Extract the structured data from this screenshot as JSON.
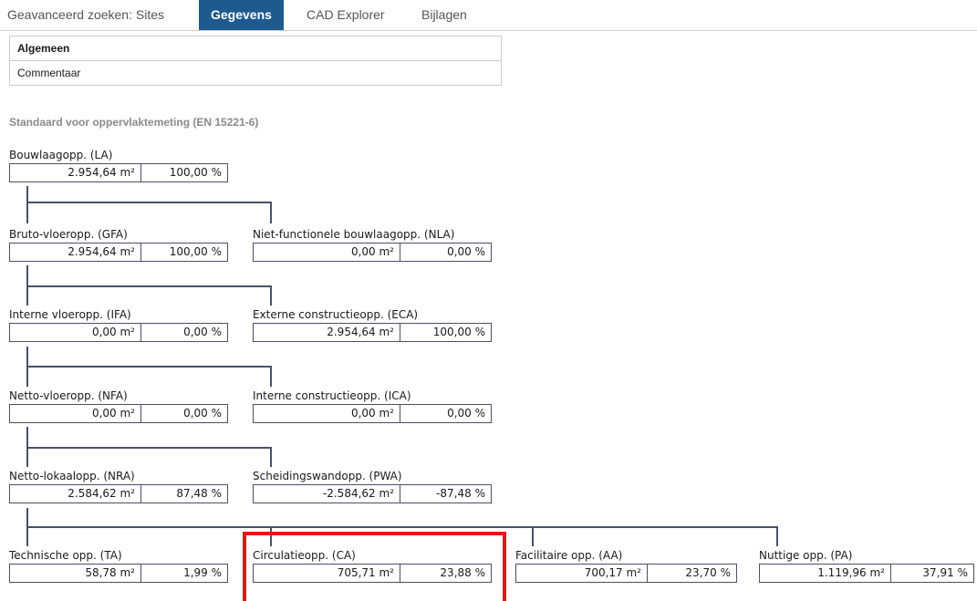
{
  "tabs": [
    {
      "label": "Geavanceerd zoeken: Sites",
      "active": false
    },
    {
      "label": "Gegevens",
      "active": true
    },
    {
      "label": "CAD Explorer",
      "active": false
    },
    {
      "label": "Bijlagen",
      "active": false
    }
  ],
  "panel": {
    "items": [
      "Algemeen",
      "Commentaar"
    ]
  },
  "section_title": "Standaard voor oppervlaktemeting (EN 15221-6)",
  "nodes": {
    "la": {
      "label": "Bouwlaagopp. (LA)",
      "area": "2.954,64 m²",
      "pct": "100,00 %"
    },
    "gfa": {
      "label": "Bruto-vloeropp. (GFA)",
      "area": "2.954,64 m²",
      "pct": "100,00 %"
    },
    "nla": {
      "label": "Niet-functionele bouwlaagopp. (NLA)",
      "area": "0,00 m²",
      "pct": "0,00 %"
    },
    "ifa": {
      "label": "Interne vloeropp. (IFA)",
      "area": "0,00 m²",
      "pct": "0,00 %"
    },
    "eca": {
      "label": "Externe constructieopp. (ECA)",
      "area": "2.954,64 m²",
      "pct": "100,00 %"
    },
    "nfa": {
      "label": "Netto-vloeropp. (NFA)",
      "area": "0,00 m²",
      "pct": "0,00 %"
    },
    "ica": {
      "label": "Interne constructieopp. (ICA)",
      "area": "0,00 m²",
      "pct": "0,00 %"
    },
    "nra": {
      "label": "Netto-lokaalopp. (NRA)",
      "area": "2.584,62 m²",
      "pct": "87,48 %"
    },
    "pwa": {
      "label": "Scheidingswandopp. (PWA)",
      "area": "-2.584,62 m²",
      "pct": "-87,48 %"
    },
    "ta": {
      "label": "Technische opp. (TA)",
      "area": "58,78 m²",
      "pct": "1,99 %"
    },
    "ca": {
      "label": "Circulatieopp. (CA)",
      "area": "705,71 m²",
      "pct": "23,88 %"
    },
    "aa": {
      "label": "Facilitaire opp. (AA)",
      "area": "700,17 m²",
      "pct": "23,70 %"
    },
    "pa": {
      "label": "Nuttige opp. (PA)",
      "area": "1.119,96 m²",
      "pct": "37,91 %"
    }
  },
  "colors": {
    "active_tab": "#1e5a8d",
    "box_border": "#4a5068",
    "highlight": "#e4141b",
    "section_title": "#8a8a8a"
  }
}
